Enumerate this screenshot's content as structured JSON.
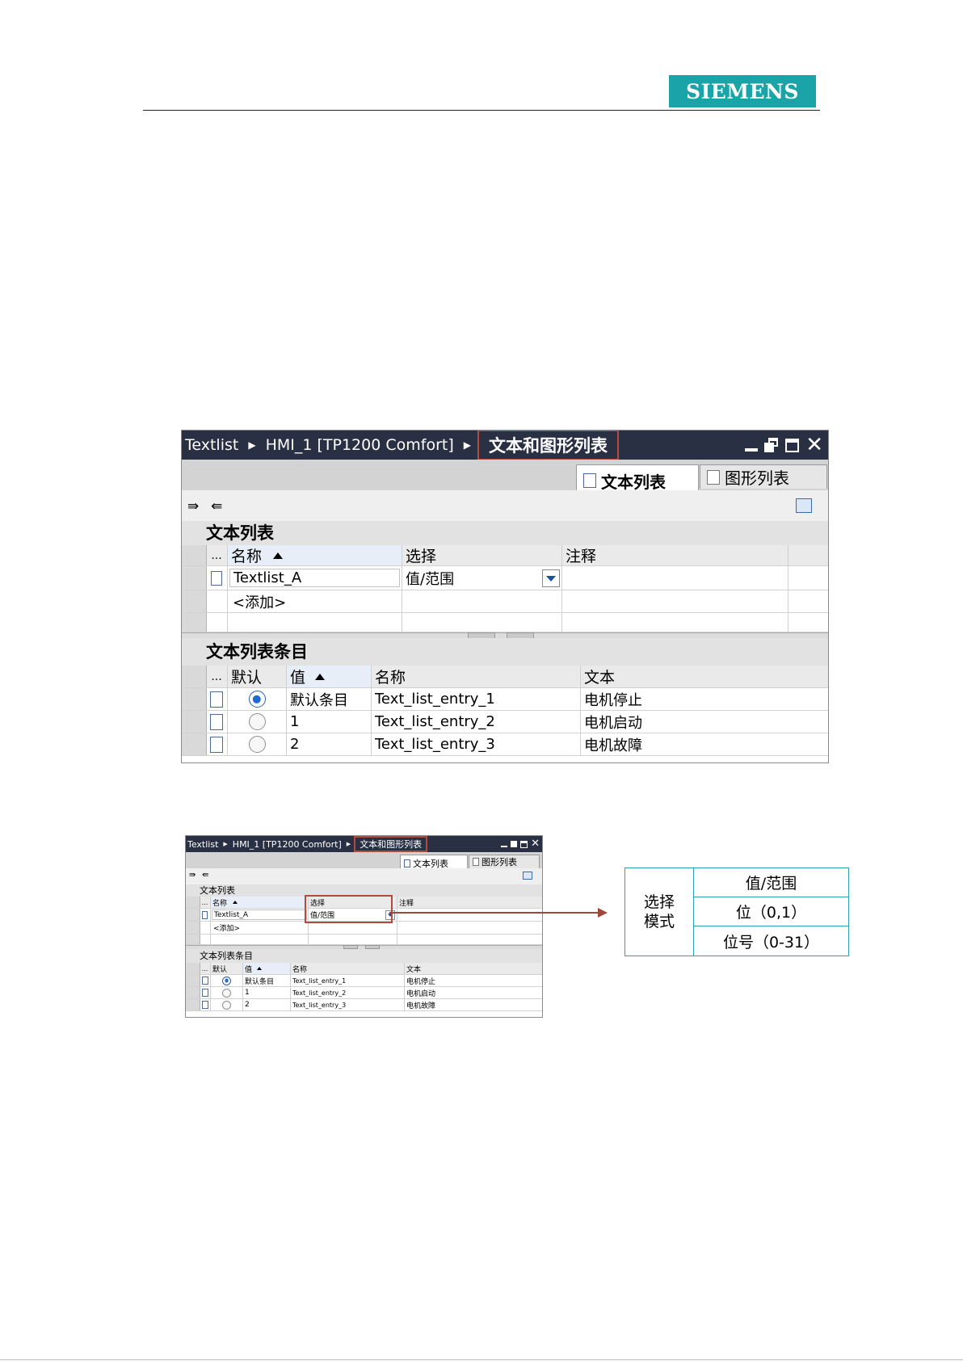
{
  "brand": {
    "logo_text": "SIEMENS",
    "logo_color": "#1aa4a8"
  },
  "editor": {
    "breadcrumb": [
      "Textlist",
      "HMI_1 [TP1200 Comfort]",
      "文本和图形列表"
    ],
    "tabs": [
      {
        "label": "文本列表",
        "active": true
      },
      {
        "label": "图形列表",
        "active": false
      }
    ],
    "textlists": {
      "title": "文本列表",
      "columns": [
        "...",
        "名称",
        "选择",
        "注释"
      ],
      "rows": [
        {
          "name": "Textlist_A",
          "selection": "值/范围",
          "comment": ""
        }
      ],
      "add_label": "<添加>"
    },
    "entries": {
      "title": "文本列表条目",
      "columns": [
        "...",
        "默认",
        "值",
        "名称",
        "文本"
      ],
      "rows": [
        {
          "default": true,
          "value": "默认条目",
          "name": "Text_list_entry_1",
          "text": "电机停止"
        },
        {
          "default": false,
          "value": "1",
          "name": "Text_list_entry_2",
          "text": "电机启动"
        },
        {
          "default": false,
          "value": "2",
          "name": "Text_list_entry_3",
          "text": "电机故障"
        }
      ]
    }
  },
  "callout": {
    "label": "选择\n模式",
    "options": [
      "值/范围",
      "位（0,1）",
      "位号（0-31）"
    ]
  },
  "colors": {
    "highlight": "#b44a3c",
    "callout_border": "#2aa2ad",
    "titlebar": "#2a3044"
  }
}
